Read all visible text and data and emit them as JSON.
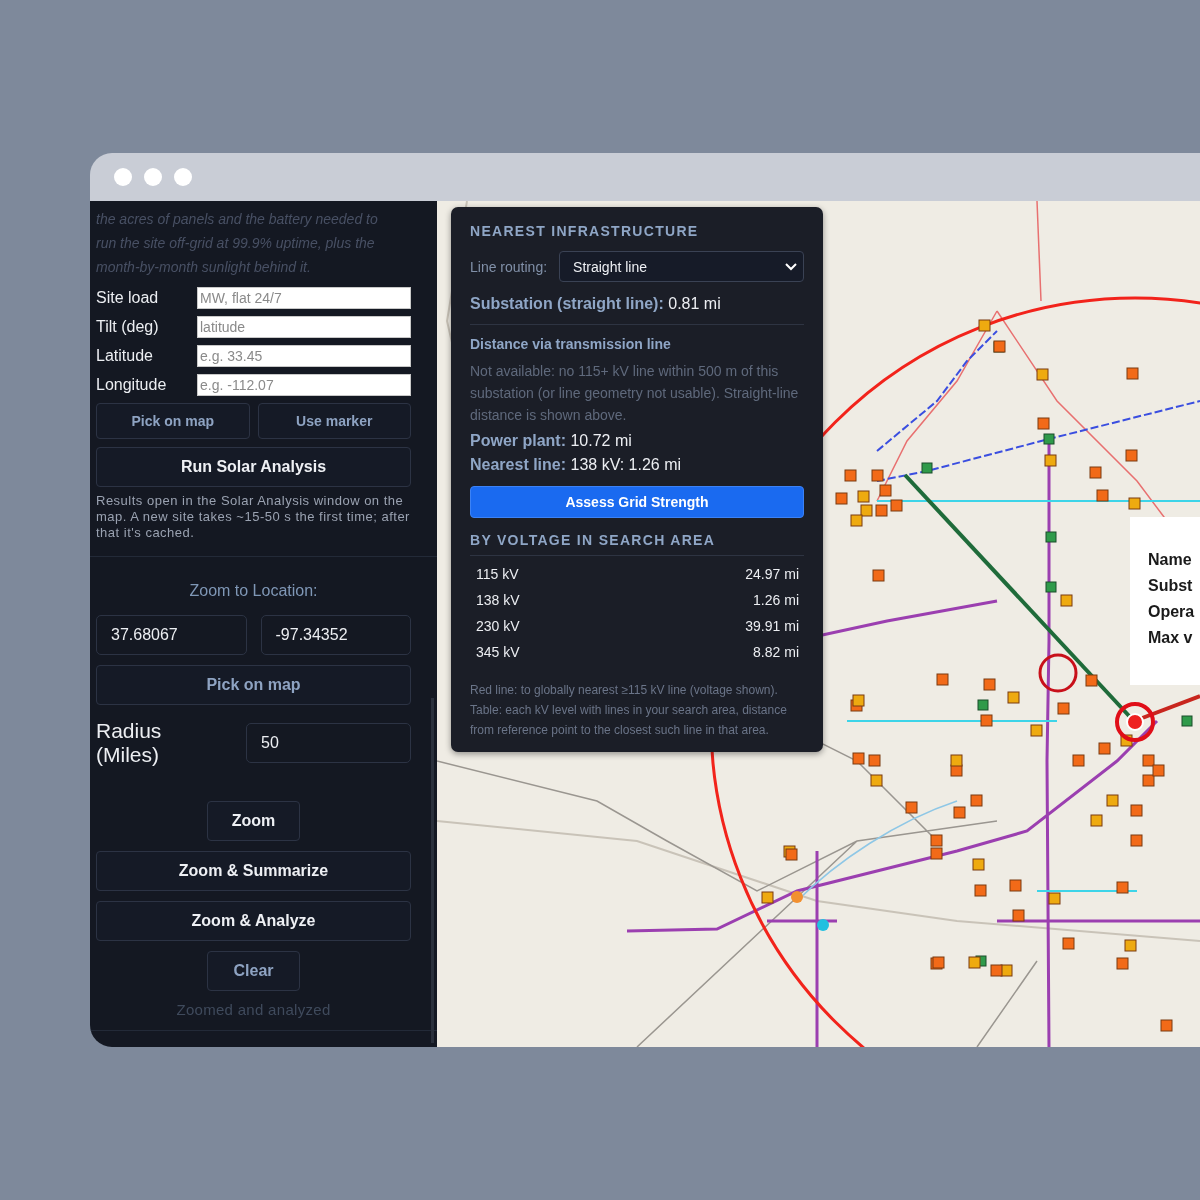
{
  "sidebar": {
    "intro": "the acres of panels and the battery needed to run the site off-grid at 99.9% uptime, plus the month-by-month sunlight behind it.",
    "fields": [
      {
        "label": "Site load",
        "placeholder": "MW, flat 24/7"
      },
      {
        "label": "Tilt (deg)",
        "placeholder": "latitude"
      },
      {
        "label": "Latitude",
        "placeholder": "e.g. 33.45"
      },
      {
        "label": "Longitude",
        "placeholder": "e.g. -112.07"
      }
    ],
    "pick_buttons": [
      "Pick on map",
      "Use marker"
    ],
    "run_button": "Run Solar Analysis",
    "note": "Results open in the Solar Analysis window on the map. A new site takes ~15-50 s the first time; after that it's cached.",
    "zoom": {
      "title": "Zoom to Location:",
      "latitude": "37.68067",
      "longitude": "-97.34352",
      "pick_button": "Pick on map",
      "radius_label": "Radius (Miles)",
      "radius": "50",
      "buttons": [
        {
          "label": "Zoom",
          "kind": "narrow"
        },
        {
          "label": "Zoom & Summarize",
          "kind": "wide"
        },
        {
          "label": "Zoom & Analyze",
          "kind": "wide"
        },
        {
          "label": "Clear",
          "kind": "muted"
        }
      ],
      "status": "Zoomed and analyzed"
    }
  },
  "infrastructure": {
    "title": "NEAREST INFRASTRUCTURE",
    "routing_label": "Line routing:",
    "routing_value": "Straight line",
    "substation": "**Substation (straight line):** 0.81 mi",
    "via_title": "Distance via transmission line",
    "via_note": "Not available: no 115+ kV line within 500 m of this substation (or line geometry not usable). Straight-line distance is shown above.",
    "facts": [
      "**Power plant:** 10.72 mi",
      "**Nearest line:** 138 kV: 1.26 mi"
    ],
    "assess_button": "Assess Grid Strength",
    "voltage_title": "BY VOLTAGE IN SEARCH AREA",
    "voltages": [
      {
        "level": "115 kV",
        "distance": "24.97 mi"
      },
      {
        "level": "138 kV",
        "distance": "1.26 mi"
      },
      {
        "level": "230 kV",
        "distance": "39.91 mi"
      },
      {
        "level": "345 kV",
        "distance": "8.82 mi"
      }
    ],
    "footnote": "Red line: to globally nearest ≥115 kV line (voltage shown). Table: each kV level with lines in your search area, distance from reference point to the closest such line in that area."
  },
  "map_popup": {
    "labels": [
      "Name",
      "Subst",
      "Opera",
      "Max v"
    ]
  }
}
